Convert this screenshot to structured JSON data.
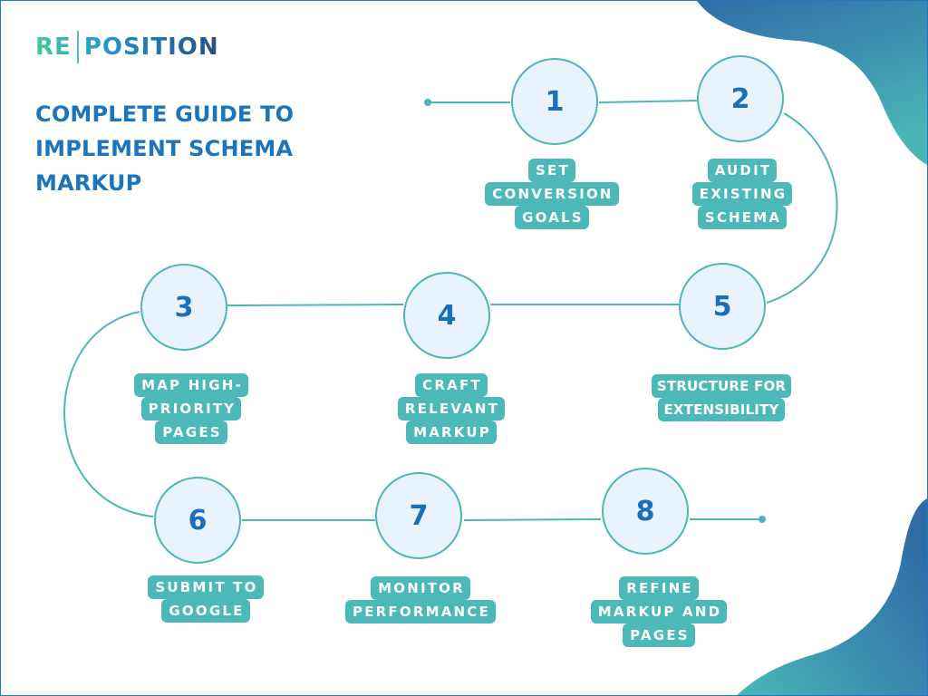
{
  "brand": {
    "prefix": "RE",
    "suffix": "POSITION"
  },
  "title_lines": [
    "COMPLETE GUIDE TO",
    "IMPLEMENT SCHEMA",
    "MARKUP"
  ],
  "colors": {
    "accent_teal": "#4db8b9",
    "title_blue": "#1a75bd",
    "circle_fill": "#e8f3fd",
    "blob_dark": "#2f6fa8",
    "blob_light": "#4ab6b8"
  },
  "steps": [
    {
      "number": "1",
      "label_lines": [
        "SET",
        "CONVERSION",
        "GOALS"
      ]
    },
    {
      "number": "2",
      "label_lines": [
        "AUDIT",
        "EXISTING",
        "SCHEMA"
      ]
    },
    {
      "number": "3",
      "label_lines": [
        "MAP HIGH-",
        "PRIORITY",
        "PAGES"
      ]
    },
    {
      "number": "4",
      "label_lines": [
        "CRAFT",
        "RELEVANT",
        "MARKUP"
      ]
    },
    {
      "number": "5",
      "label_lines": [
        "STRUCTURE FOR",
        "EXTENSIBILITY"
      ]
    },
    {
      "number": "6",
      "label_lines": [
        "SUBMIT TO",
        "GOOGLE"
      ]
    },
    {
      "number": "7",
      "label_lines": [
        "MONITOR",
        "PERFORMANCE"
      ]
    },
    {
      "number": "8",
      "label_lines": [
        "REFINE",
        "MARKUP AND",
        "PAGES"
      ]
    }
  ]
}
